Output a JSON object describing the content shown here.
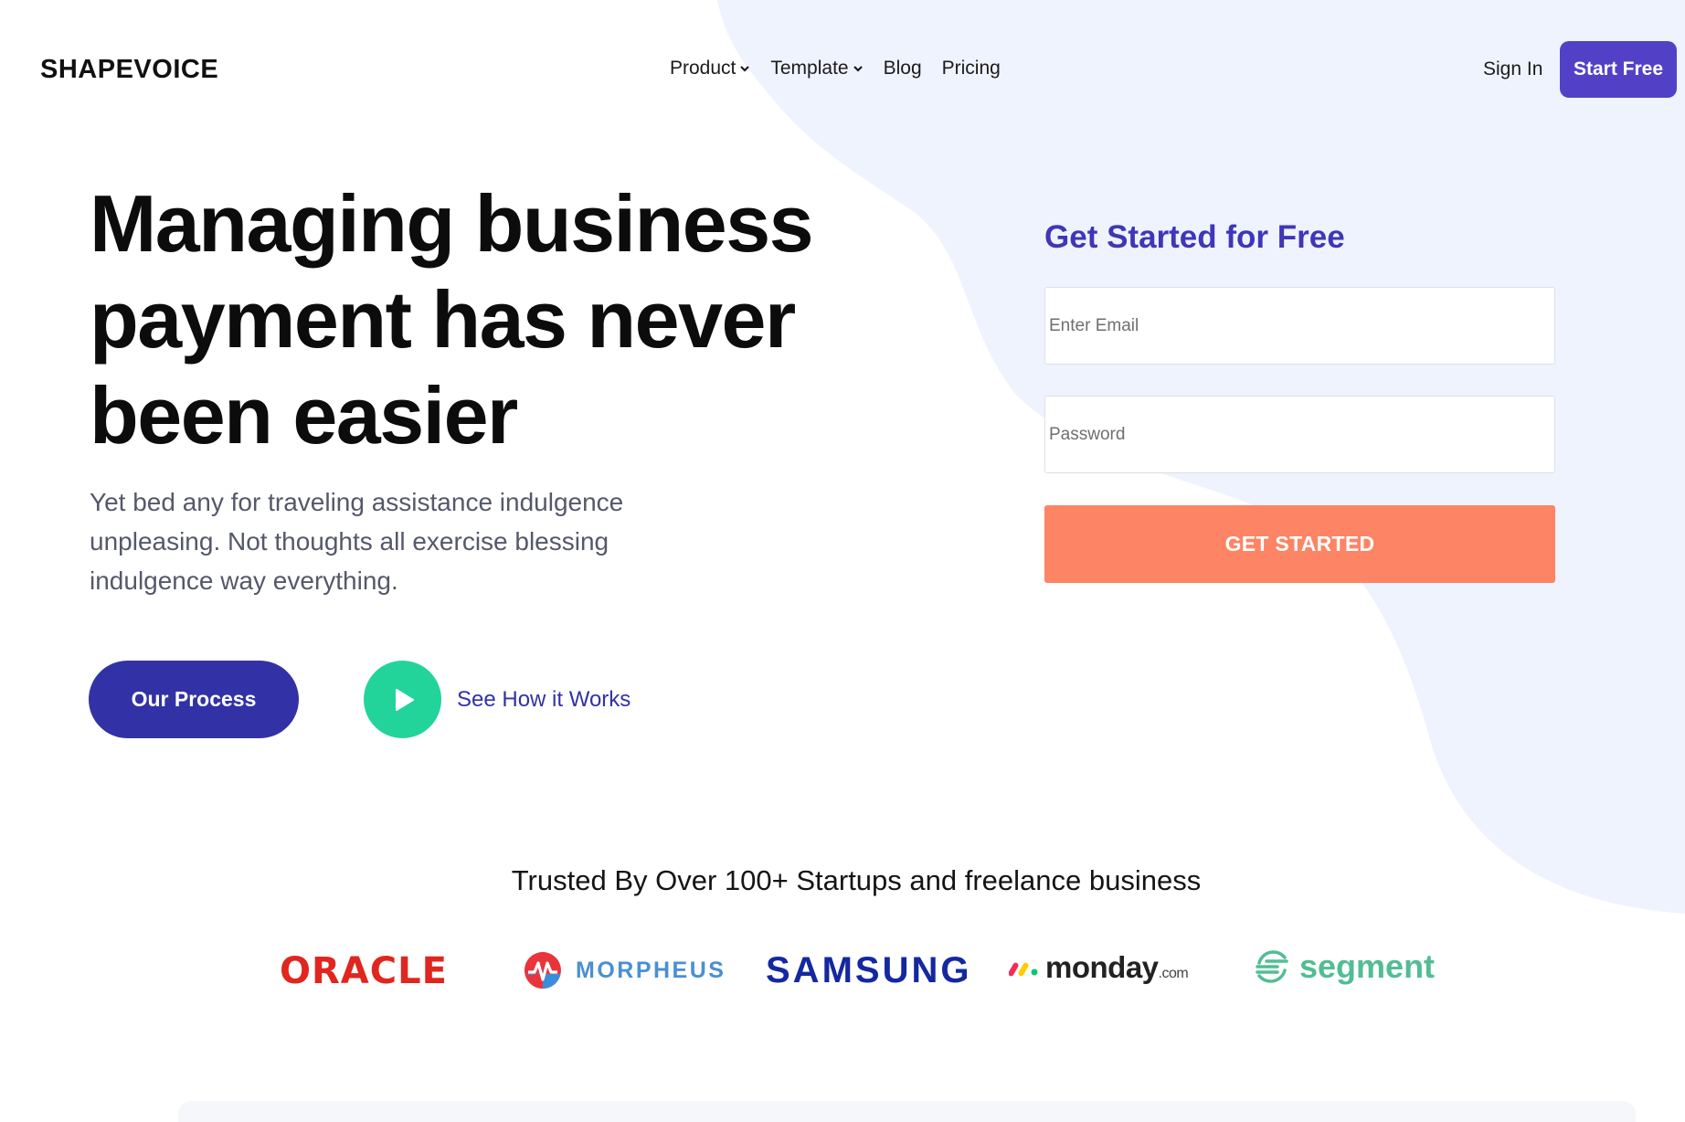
{
  "header": {
    "brand": "SHAPEVOICE",
    "nav": [
      {
        "label": "Product",
        "dropdown": true
      },
      {
        "label": "Template",
        "dropdown": true
      },
      {
        "label": "Blog",
        "dropdown": false
      },
      {
        "label": "Pricing",
        "dropdown": false
      }
    ],
    "sign_in": "Sign In",
    "start_free": "Start Free"
  },
  "hero": {
    "title": "Managing business payment has never been easier",
    "subtitle": "Yet bed any for traveling assistance indulgence unpleasing. Not thoughts all exercise blessing indulgence way everything.",
    "primary_button": "Our Process",
    "video_link": "See How it Works"
  },
  "form": {
    "title": "Get Started for Free",
    "email_placeholder": "Enter Email",
    "password_placeholder": "Password",
    "submit": "GET STARTED"
  },
  "trusted": {
    "heading": "Trusted By Over 100+ Startups and freelance business",
    "logos": [
      "ORACLE",
      "MORPHEUS",
      "SAMSUNG",
      "monday",
      ".com",
      "segment"
    ]
  },
  "colors": {
    "primary": "#3232a6",
    "accent_orange": "#fd8464",
    "accent_green": "#22d49a",
    "bg_blob": "#eff3fe"
  }
}
